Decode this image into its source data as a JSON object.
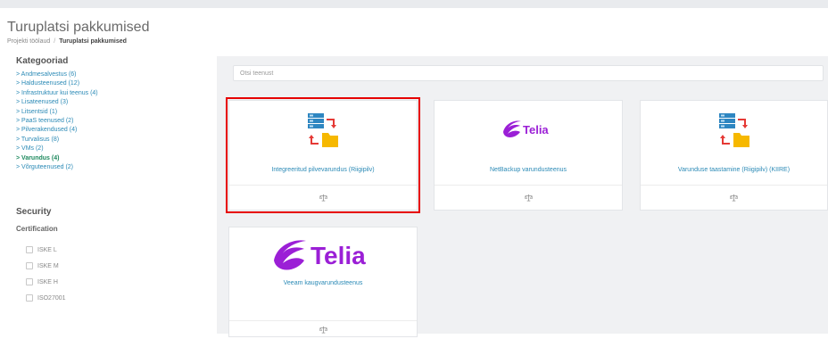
{
  "page": {
    "title": "Turuplatsi pakkumised",
    "breadcrumb": {
      "parent": "Projekti töölaud",
      "separator": "/",
      "current": "Turuplatsi pakkumised"
    }
  },
  "sidebar": {
    "categories_heading": "Kategooriad",
    "categories": [
      {
        "label": "> Andmesalvestus (6)"
      },
      {
        "label": "> Haldusteenused (12)"
      },
      {
        "label": "> Infrastruktuur kui teenus (4)"
      },
      {
        "label": "> Lisateenused (3)"
      },
      {
        "label": "> Litsentsid (1)"
      },
      {
        "label": "> PaaS teenused (2)"
      },
      {
        "label": "> Pilverakendused (4)"
      },
      {
        "label": "> Turvalisus (8)"
      },
      {
        "label": "> VMs (2)"
      },
      {
        "label": "> Varundus (4)",
        "active": true
      },
      {
        "label": "> Võrguteenused (2)"
      }
    ],
    "security_heading": "Security",
    "certification_heading": "Certification",
    "certifications": [
      {
        "label": "ISKE L",
        "checked": false
      },
      {
        "label": "ISKE M",
        "checked": false
      },
      {
        "label": "ISKE H",
        "checked": false
      },
      {
        "label": "ISO27001",
        "checked": false
      }
    ]
  },
  "search": {
    "placeholder": "Otsi teenust",
    "value": ""
  },
  "offers": [
    {
      "title": "Integreeritud pilvevarundus (Riigipilv)",
      "icon": "backup-server-folder-icon",
      "selected": true
    },
    {
      "title": "NetBackup varundusteenus",
      "icon": "telia-logo",
      "logo_text": "Telia",
      "selected": false
    },
    {
      "title": "Varunduse taastamine (Riigipilv) (KIIRE)",
      "icon": "backup-server-folder-icon",
      "selected": false
    },
    {
      "title": "Veeam kaugvarundusteenus",
      "icon": "telia-logo",
      "logo_text": "Telia",
      "selected": false
    }
  ],
  "colors": {
    "link": "#2b8ab6",
    "active_category": "#1f8a5f",
    "selection": "#e60000",
    "telia_purple": "#9b1fd6",
    "folder": "#f6b800",
    "server": "#2e86c1"
  }
}
